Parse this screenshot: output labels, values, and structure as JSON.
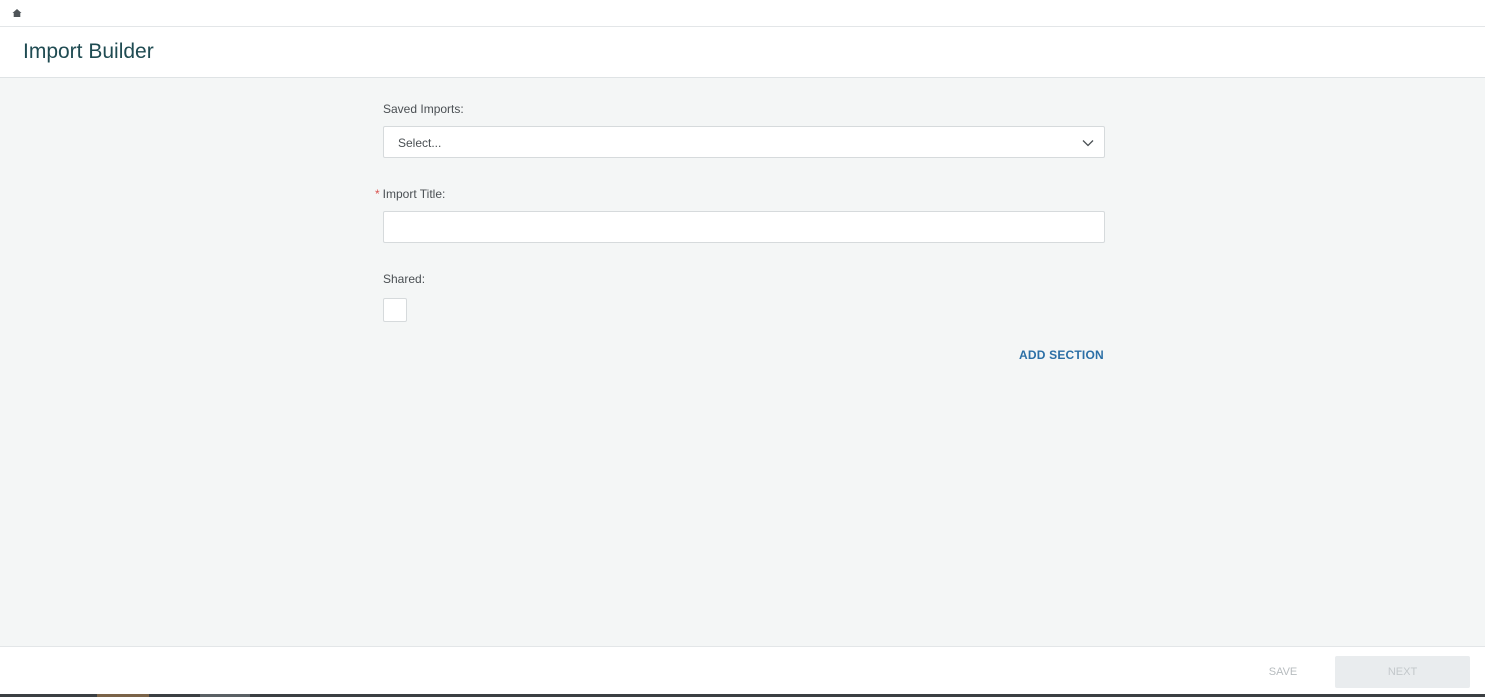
{
  "topbar": {
    "home_icon": "home-icon"
  },
  "header": {
    "title": "Import Builder"
  },
  "form": {
    "saved_imports": {
      "label": "Saved Imports:",
      "selected_value": "Select...",
      "icon": "chevron-down-icon"
    },
    "import_title": {
      "required_marker": "*",
      "label": "Import Title:",
      "value": "",
      "placeholder": ""
    },
    "shared": {
      "label": "Shared:",
      "checked": false
    },
    "add_section_label": "ADD SECTION"
  },
  "footer": {
    "save_label": "SAVE",
    "next_label": "NEXT"
  },
  "colors": {
    "title": "#1f4b52",
    "link_accent": "#2b6fa6",
    "required": "#d9534f",
    "background": "#f4f6f6"
  }
}
